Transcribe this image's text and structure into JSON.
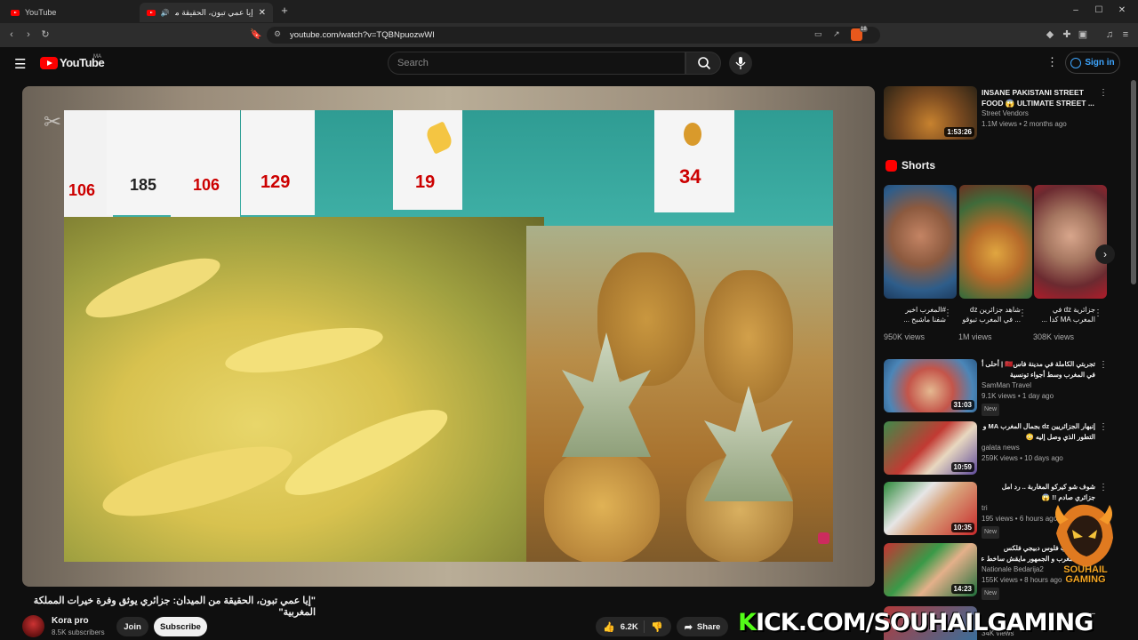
{
  "browser": {
    "tabs": [
      {
        "label": "YouTube"
      },
      {
        "label": "إيا عمي تبون، الحقيقة من الميدا..."
      }
    ],
    "url": "youtube.com/watch?v=TQBNpuozwWI",
    "extension_badge": "18"
  },
  "masthead": {
    "logo_text": "YouTube",
    "country_code": "MA",
    "search_placeholder": "Search",
    "signin_label": "Sign in"
  },
  "video": {
    "title": "\"إيا عمي تبون، الحقيقة من الميدان: جزائري يوثق وفرة خيرات المملكة المغربية\"",
    "channel_name": "Kora pro",
    "subscribers": "8.5K subscribers",
    "join_label": "Join",
    "subscribe_label": "Subscribe",
    "likes": "6.2K",
    "share_label": "Share",
    "price_tags": [
      "106",
      "185",
      "106",
      "129",
      "19",
      "34"
    ]
  },
  "sidebar": {
    "top_video": {
      "title_line1": "INSANE PAKISTANI STREET",
      "title_line2": "FOOD 😱 ULTIMATE STREET ...",
      "channel": "Street Vendors",
      "meta": "1.1M views • 2 months ago",
      "duration": "1:53:26"
    },
    "shorts_heading": "Shorts",
    "shorts": [
      {
        "title_line1": "#المغرب اخير",
        "title_line2": "شفنا ماشبح ...",
        "views": "950K views"
      },
      {
        "title_line1": "شاهد جزائرين dz",
        "title_line2": "... في المغرب تبوقو",
        "views": "1M views"
      },
      {
        "title_line1": "جزائرية dz في",
        "title_line2": "المغرب MA كدا ...",
        "views": "308K views"
      }
    ],
    "videos": [
      {
        "title_line1": "تجربتي الكاملة في مدينة فاس🇲🇦 | أحلى أكل",
        "title_line2": "في المغرب وسط أجواء تونسية",
        "channel": "SamMan Travel",
        "meta": "9.1K views • 1 day ago",
        "badge": "New",
        "duration": "31:03"
      },
      {
        "title_line1": "إنبهار الجزائريين dz بجمال المغرب MA و",
        "title_line2": "التطور الذي وصل إليه 😳",
        "channel": "galata news",
        "meta": "259K views • 10 days ago",
        "badge": "",
        "duration": "10:59"
      },
      {
        "title_line1": "شوف شو كيركو المغاربة .. رد امل",
        "title_line2": "جزائري صادم !! 😱",
        "channel": "tri",
        "meta": "195 views • 6 hours ago",
        "badge": "New",
        "duration": "10:35"
      },
      {
        "title_line1": "شاهد صاحب فلوس دبيجي فلكس",
        "title_line2": "... في المغرب و الجمهور مايقش ساخط على",
        "channel": "Nationale Bedarija2",
        "meta": "155K views • 8 hours ago",
        "badge": "New",
        "duration": "14:23"
      },
      {
        "title_line1": "...",
        "title_line2": "",
        "channel": "",
        "meta": "34K views",
        "badge": "",
        "duration": ""
      }
    ]
  },
  "overlay": {
    "kick_prefix": "K",
    "kick_rest": "ICK.COM/SOUHAILGAMING",
    "logo_line1": "SOUHAIL",
    "logo_line2": "GAMING"
  },
  "colors": {
    "accent_red": "#ff0000",
    "link_blue": "#3ea6ff",
    "kick_green": "#53fc18"
  }
}
